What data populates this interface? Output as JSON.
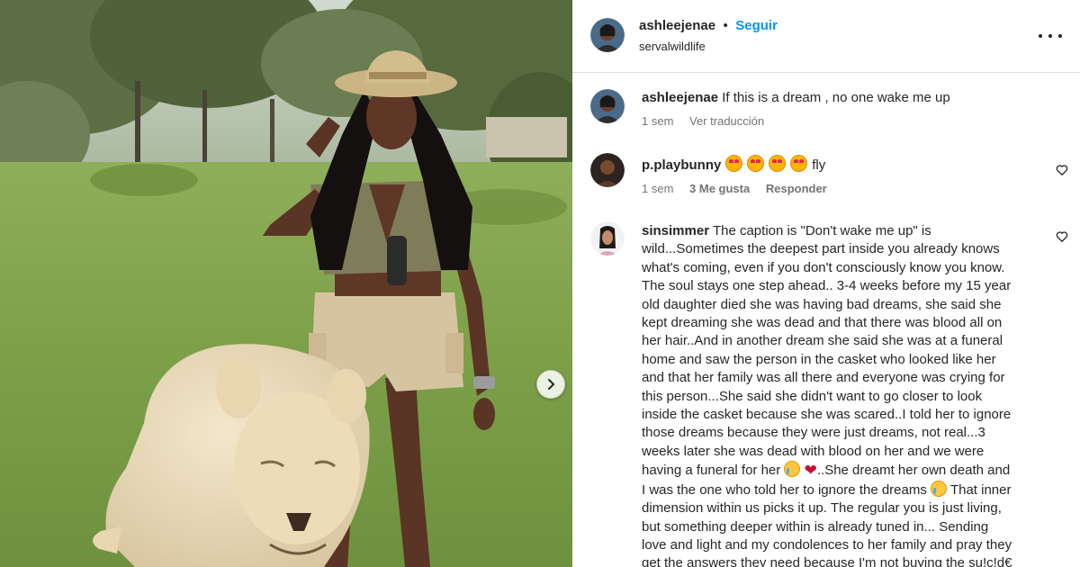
{
  "post": {
    "username": "ashleejenae",
    "separator": "•",
    "follow_label": "Seguir",
    "location": "servalwildlife"
  },
  "comments": [
    {
      "user": "ashleejenae",
      "text": "If this is a dream , no one wake me up",
      "time": "1 sem",
      "translate_label": "Ver traducción"
    },
    {
      "user": "p.playbunny",
      "emojis": [
        "star-struck-emoji",
        "star-struck-emoji",
        "star-struck-emoji",
        "star-struck-emoji"
      ],
      "text": "fly",
      "time": "1 sem",
      "likes": "3 Me gusta",
      "reply_label": "Responder"
    },
    {
      "user": "sinsimmer",
      "text_part1": "The caption is \"Don't wake me up\" is wild...Sometimes the deepest part inside you already knows what's coming, even if you don't consciously know you know. The soul stays one step ahead.. 3-4 weeks before my 15 year old daughter died she was having bad dreams, she said she kept dreaming she was dead and that there was blood all on her hair..And in another dream she said she was at a funeral home and saw the person in the casket who looked like her and that her family was all there and everyone was crying for this person...She said she didn't want to go closer to look inside the casket because she was scared..I told her to ignore those dreams because they were just dreams, not real...3 weeks later she was dead with blood on her and we were having a funeral for her",
      "emoji_1": "crying-emoji",
      "emoji_2": "broken-heart-emoji",
      "text_part2": "..She dreamt her own death and I was the one who told her to ignore the dreams",
      "emoji_3": "crying-emoji",
      "text_part3": "That inner dimension within us picks it up. The regular you is just living, but something deeper within is already tuned in... Sending love and light and my condolences to her family and pray they get the answers they need because I'm not buying the su!c!d€"
    }
  ],
  "colors": {
    "follow": "#0095f6",
    "text": "#262626",
    "meta": "#737373",
    "divider": "#dbdbdb"
  }
}
